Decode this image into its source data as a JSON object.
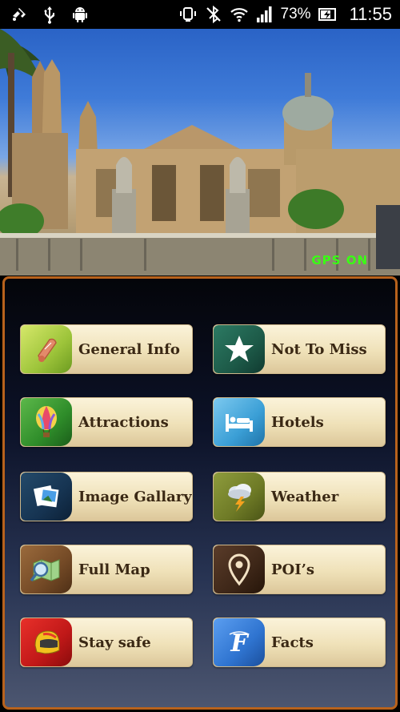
{
  "status_bar": {
    "battery_percent": "73%",
    "time": "11:55",
    "left_icons": [
      "usb-debug-icon",
      "usb-icon",
      "android-icon"
    ],
    "right_icons": [
      "vibrate-icon",
      "bluetooth-off-icon",
      "wifi-icon",
      "signal-icon",
      "battery-charging-icon"
    ]
  },
  "hero": {
    "gps_status": "GPS ON",
    "gps_color": "#39ff14"
  },
  "menu": {
    "items": [
      {
        "label": "General Info",
        "icon": "scroll-icon"
      },
      {
        "label": "Not To Miss",
        "icon": "star-icon"
      },
      {
        "label": "Attractions",
        "icon": "hot-air-balloon-icon"
      },
      {
        "label": "Hotels",
        "icon": "bed-icon"
      },
      {
        "label": "Image Gallary",
        "icon": "photos-icon"
      },
      {
        "label": "Weather",
        "icon": "storm-cloud-icon"
      },
      {
        "label": "Full Map",
        "icon": "map-magnifier-icon"
      },
      {
        "label": "POI’s",
        "icon": "map-pin-icon"
      },
      {
        "label": "Stay safe",
        "icon": "helmet-icon"
      },
      {
        "label": "Facts",
        "icon": "fact-f-icon"
      }
    ]
  },
  "colors": {
    "panel_border": "#b8621c",
    "button_text": "#3a2814"
  }
}
